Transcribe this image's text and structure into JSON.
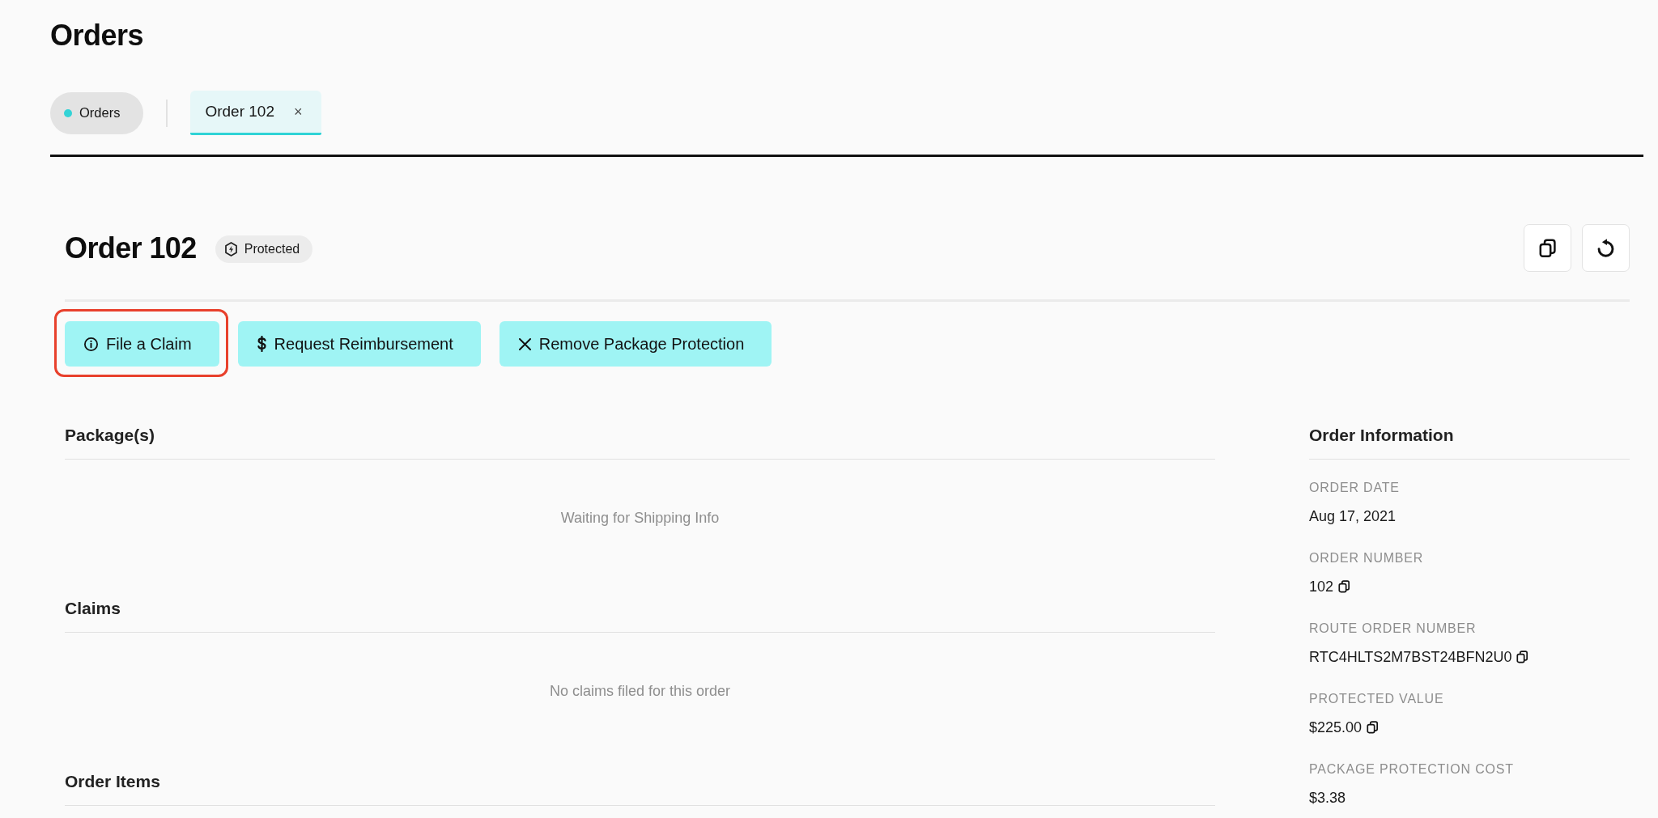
{
  "page": {
    "title": "Orders"
  },
  "tabs": [
    {
      "label": "Orders",
      "kind": "home",
      "selected": false
    },
    {
      "label": "Order 102",
      "kind": "detail",
      "selected": true,
      "close": "×"
    }
  ],
  "order": {
    "title": "Order 102",
    "badge": "Protected"
  },
  "actions": [
    {
      "label": "File a Claim",
      "kind": "info",
      "highlighted": true
    },
    {
      "label": "Request Reimbursement",
      "kind": "dollar",
      "highlighted": false
    },
    {
      "label": "Remove Package Protection",
      "kind": "remove",
      "highlighted": false
    }
  ],
  "sections": [
    {
      "title": "Package(s)",
      "empty_text": "Waiting for Shipping Info"
    },
    {
      "title": "Claims",
      "empty_text": "No claims filed for this order"
    },
    {
      "title": "Order Items"
    }
  ],
  "order_information": {
    "title": "Order Information",
    "fields": [
      {
        "label": "ORDER DATE",
        "value": "Aug 17, 2021",
        "copyable": false
      },
      {
        "label": "ORDER NUMBER",
        "value": "102",
        "copyable": true
      },
      {
        "label": "ROUTE ORDER NUMBER",
        "value": "RTC4HLTS2M7BST24BFN2U0",
        "copyable": true
      },
      {
        "label": "PROTECTED VALUE",
        "value": "$225.00",
        "copyable": true
      },
      {
        "label": "PACKAGE PROTECTION COST",
        "value": "$3.38",
        "copyable": false
      }
    ]
  }
}
